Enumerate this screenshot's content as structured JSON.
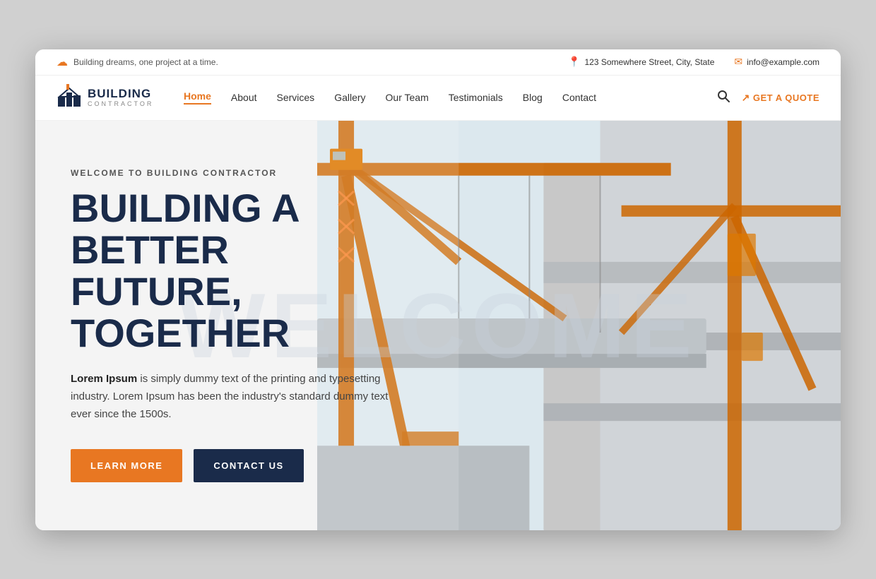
{
  "info_bar": {
    "tagline": "Building dreams, one project at a time.",
    "address": "123 Somewhere Street, City, State",
    "email": "info@example.com"
  },
  "logo": {
    "title": "BUILDING",
    "subtitle": "CONTRACTOR"
  },
  "nav": {
    "links": [
      {
        "label": "Home",
        "active": true
      },
      {
        "label": "About",
        "active": false
      },
      {
        "label": "Services",
        "active": false
      },
      {
        "label": "Gallery",
        "active": false
      },
      {
        "label": "Our Team",
        "active": false
      },
      {
        "label": "Testimonials",
        "active": false
      },
      {
        "label": "Blog",
        "active": false
      },
      {
        "label": "Contact",
        "active": false
      }
    ],
    "quote_label": "GET A QUOTE"
  },
  "hero": {
    "watermark": "WELCOME",
    "eyebrow": "WELCOME TO BUILDING CONTRACTOR",
    "title_line1": "BUILDING A BETTER",
    "title_line2": "FUTURE, TOGETHER",
    "description_bold": "Lorem Ipsum",
    "description_rest": " is simply dummy text of the printing and typesetting industry. Lorem Ipsum has been the industry's standard dummy text ever since the 1500s.",
    "btn_learn_more": "LEARN MORE",
    "btn_contact_us": "CONTACT US"
  },
  "colors": {
    "orange": "#e87722",
    "navy": "#1a2b4a",
    "light_bg": "#f4f4f4"
  }
}
